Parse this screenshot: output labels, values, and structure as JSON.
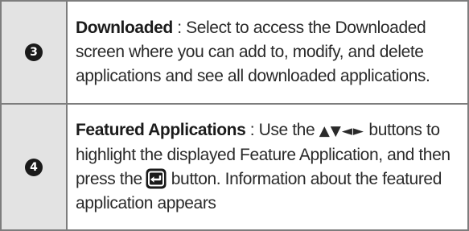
{
  "rows": [
    {
      "number": "3",
      "title": "Downloaded",
      "separator": " : ",
      "text": "Select to access the Downloaded screen where you can add to, modify, and delete applications and see all downloaded applications."
    },
    {
      "number": "4",
      "title": "Featured Applications",
      "separator": " : ",
      "text_before_arrows": "Use the ",
      "arrows": "▲▼◄►",
      "text_after_arrows": " buttons to highlight the displayed Feature Application, and then press the",
      "icon": "enter-button-icon",
      "text_after_icon": "button. Information about the featured application appears"
    }
  ]
}
